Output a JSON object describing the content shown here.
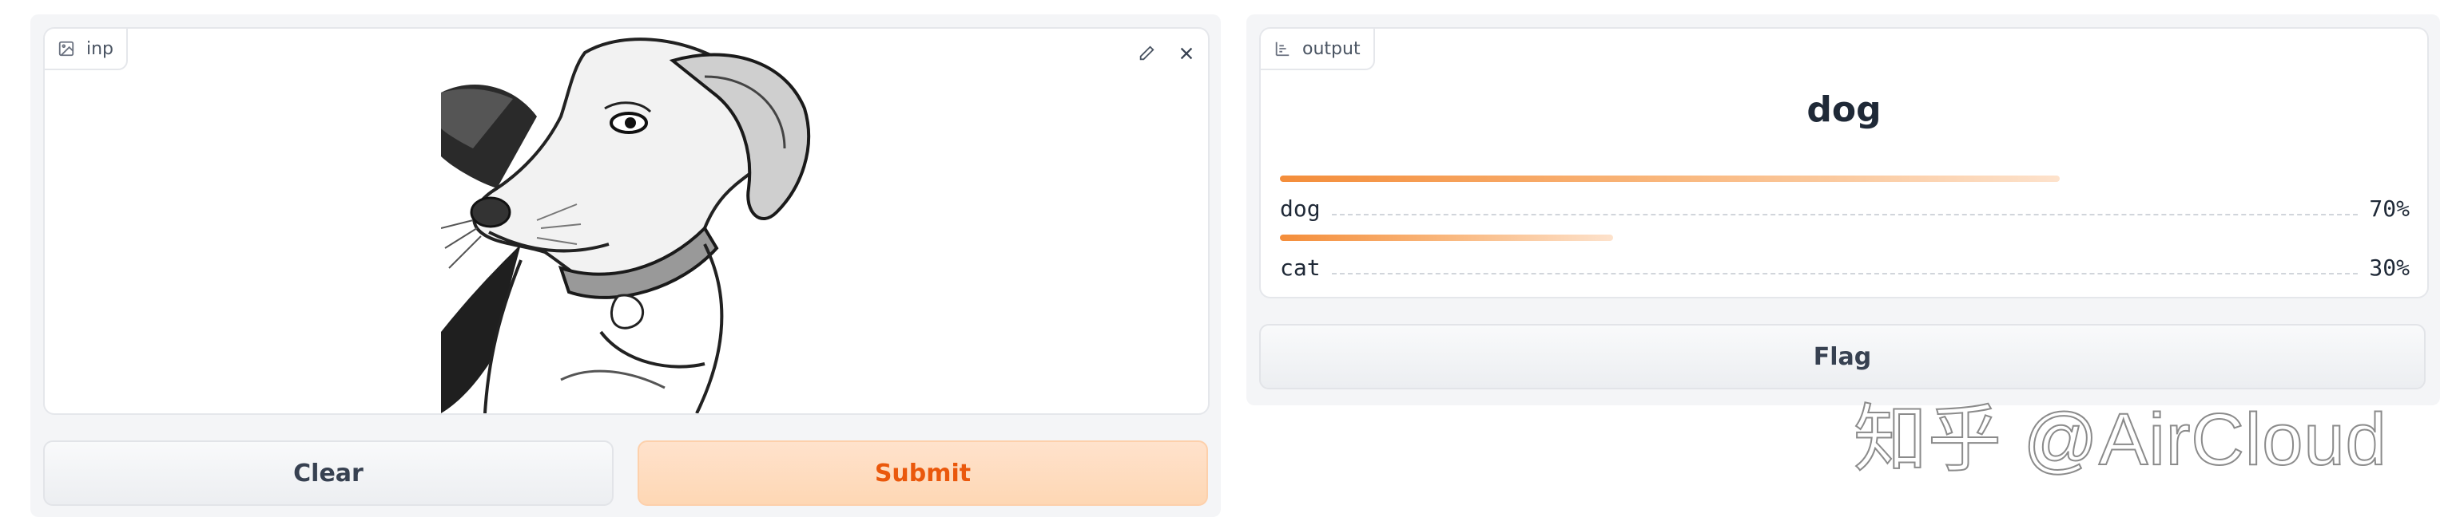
{
  "input": {
    "label": "inp",
    "image_icon": "image-icon",
    "edit_icon": "pencil-icon",
    "close_icon": "close-icon"
  },
  "buttons": {
    "clear": "Clear",
    "submit": "Submit",
    "flag": "Flag"
  },
  "output": {
    "label": "output",
    "label_icon": "bar-chart-icon",
    "predicted": "dog",
    "confidences": [
      {
        "label": "dog",
        "value": 0.7,
        "display": "70%"
      },
      {
        "label": "cat",
        "value": 0.3,
        "display": "30%"
      }
    ]
  },
  "watermark": "知乎 @AirCloud",
  "colors": {
    "accent": "#f48d3a",
    "submit_bg": "#fed7b4",
    "submit_text": "#ea580c",
    "panel_bg": "#f4f5f7"
  }
}
